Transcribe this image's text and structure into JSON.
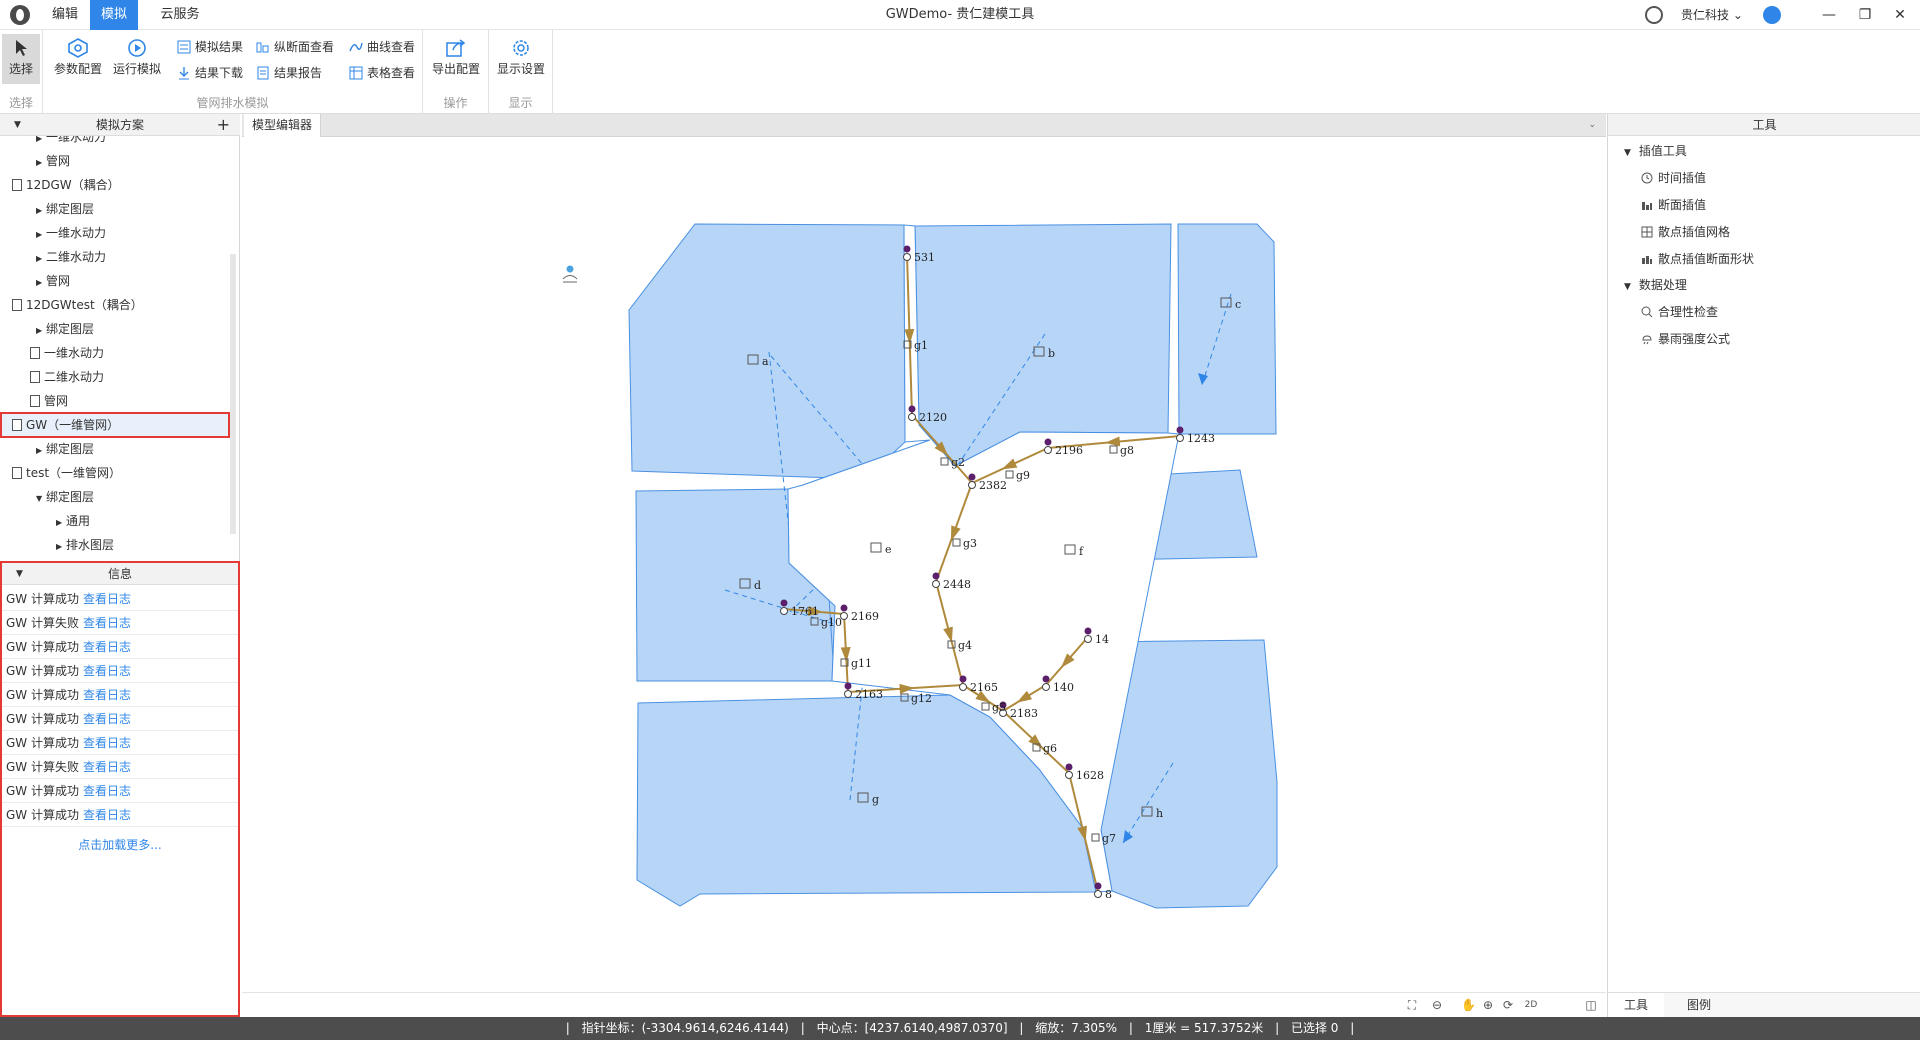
{
  "titlebar": {
    "tabs": [
      "编辑",
      "模拟",
      "云服务"
    ],
    "active_tab": "模拟",
    "title": "GWDemo- 贵仁建模工具",
    "company": "贵仁科技",
    "company_caret": "⌄",
    "minimize": "—",
    "restore": "❐",
    "close": "✕"
  },
  "ribbon": {
    "select_label": "选择",
    "params_label": "参数配置",
    "run_label": "运行模拟",
    "sim_result": "模拟结果",
    "profile_view": "纵断面查看",
    "curve_view": "曲线查看",
    "result_download": "结果下载",
    "result_report": "结果报告",
    "table_view": "表格查看",
    "export_config": "导出配置",
    "display_settings": "显示设置",
    "group_select": "选择",
    "group_pipe": "管网排水模拟",
    "group_operate": "操作",
    "group_display": "显示"
  },
  "left": {
    "header": "模拟方案",
    "plus": "+",
    "tree": [
      {
        "label": "一维水动力",
        "level": 2,
        "type": "arrow"
      },
      {
        "label": "管网",
        "level": 2,
        "type": "arrow"
      },
      {
        "label": "12DGW（耦合）",
        "level": 0,
        "type": "doc"
      },
      {
        "label": "绑定图层",
        "level": 2,
        "type": "arrow"
      },
      {
        "label": "一维水动力",
        "level": 2,
        "type": "arrow"
      },
      {
        "label": "二维水动力",
        "level": 2,
        "type": "arrow"
      },
      {
        "label": "管网",
        "level": 2,
        "type": "arrow"
      },
      {
        "label": "12DGWtest（耦合）",
        "level": 0,
        "type": "doc"
      },
      {
        "label": "绑定图层",
        "level": 2,
        "type": "arrow"
      },
      {
        "label": "一维水动力",
        "level": 1,
        "type": "doc"
      },
      {
        "label": "二维水动力",
        "level": 1,
        "type": "doc"
      },
      {
        "label": "管网",
        "level": 1,
        "type": "doc"
      },
      {
        "label": "GW（一维管网）",
        "level": 0,
        "type": "doc",
        "highlight": true
      },
      {
        "label": "绑定图层",
        "level": 2,
        "type": "arrow"
      },
      {
        "label": "test（一维管网）",
        "level": 0,
        "type": "doc"
      },
      {
        "label": "绑定图层",
        "level": 2,
        "type": "arrow-open"
      },
      {
        "label": "通用",
        "level": 3,
        "type": "arrow"
      },
      {
        "label": "排水图层",
        "level": 3,
        "type": "arrow"
      }
    ]
  },
  "info": {
    "header": "信息",
    "rows": [
      {
        "text": "GW 计算成功",
        "link": "查看日志"
      },
      {
        "text": "GW 计算失败",
        "link": "查看日志"
      },
      {
        "text": "GW 计算成功",
        "link": "查看日志"
      },
      {
        "text": "GW 计算成功",
        "link": "查看日志"
      },
      {
        "text": "GW 计算成功",
        "link": "查看日志"
      },
      {
        "text": "GW 计算成功",
        "link": "查看日志"
      },
      {
        "text": "GW 计算成功",
        "link": "查看日志"
      },
      {
        "text": "GW 计算失败",
        "link": "查看日志"
      },
      {
        "text": "GW 计算成功",
        "link": "查看日志"
      },
      {
        "text": "GW 计算成功",
        "link": "查看日志"
      }
    ],
    "load_more": "点击加载更多..."
  },
  "editor": {
    "tab": "模型编辑器",
    "tab_menu": "⌄"
  },
  "map": {
    "catchments": [
      "a",
      "b",
      "c",
      "d",
      "e",
      "f",
      "g",
      "h"
    ],
    "nodes": [
      "531",
      "2120",
      "2196",
      "1243",
      "2382",
      "2448",
      "1761",
      "2169",
      "2163",
      "2165",
      "2183",
      "14",
      "140",
      "1628",
      "8"
    ],
    "conduits": [
      "g1",
      "g2",
      "g3",
      "g4",
      "g5",
      "g6",
      "g7",
      "g8",
      "g9",
      "g10",
      "g11",
      "g12"
    ]
  },
  "map_toolbar": {
    "mode_2d": "2D"
  },
  "right": {
    "header": "工具",
    "section1": "插值工具",
    "time_interp": "时间插值",
    "section_interp": "断面插值",
    "scatter_grid": "散点插值网格",
    "scatter_section": "散点插值断面形状",
    "section2": "数据处理",
    "check": "合理性检查",
    "rain_formula": "暴雨强度公式",
    "tab_tools": "工具",
    "tab_legend": "图例"
  },
  "status": {
    "pointer": "指针坐标：(-3304.9614,6246.4144)",
    "center": "中心点：[4237.6140,4987.0370]",
    "zoom": "缩放：7.305%",
    "scale": "1厘米 = 517.3752米",
    "selected": "已选择 0"
  },
  "colors": {
    "accent": "#2f86e8",
    "catchment_fill": "#b7d6f7",
    "catchment_stroke": "#4a90e2",
    "conduit": "#b08a3c",
    "node": "#5b1f6b",
    "highlight": "#e53935",
    "status_bg": "#4d4d4d"
  }
}
